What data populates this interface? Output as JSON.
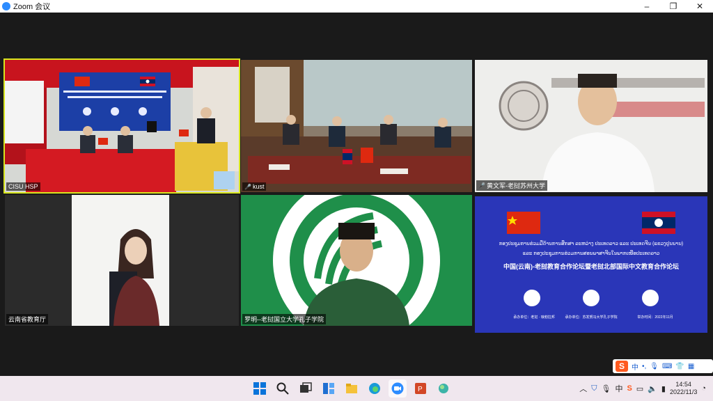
{
  "window": {
    "title": "Zoom 会议",
    "minimize": "–",
    "restore": "❐",
    "close": "✕"
  },
  "participants": [
    {
      "name": "CISU HSP",
      "muted": false
    },
    {
      "name": "kust",
      "muted": true
    },
    {
      "name": "黄文军-老挝苏州大学",
      "muted": true
    },
    {
      "name": "云南省教育厅",
      "muted": false
    },
    {
      "name": "罗明--老挝国立大学孔子学院",
      "muted": false
    }
  ],
  "shared_banner": {
    "lao_line1": "ກອງປະຊຸມການຮ່ວມມືດ້ານການສຶກສາ ລະຫວ່າງ ປະເທດລາວ ແລະ ປະເທດຈີນ (ແຂວງຢູນນານ)",
    "lao_line2": "ແລະ ກອງປະຊຸມການຮ່ວມການສອນພາສາຈີນໃນພາກເໜືອປະເທດລາວ",
    "cn_title": "中国(云南)-老挝教育合作论坛暨老挝北部国际中文教育合作论坛",
    "organizer_left": "承办单位：老挝 · 琅勃拉邦",
    "organizer_mid": "承办单位：苏发努冯大学孔子学院",
    "date": "举办时间：2022年11月"
  },
  "ime": {
    "logo": "S",
    "mode": "中",
    "punct": "•,"
  },
  "taskbar": {
    "icons": [
      "windows-start",
      "search",
      "task-view",
      "widgets",
      "file-explorer",
      "edge",
      "zoom",
      "powerpoint",
      "app"
    ],
    "tray_lang": "中",
    "time": "14:54",
    "date": "2022/11/3"
  }
}
